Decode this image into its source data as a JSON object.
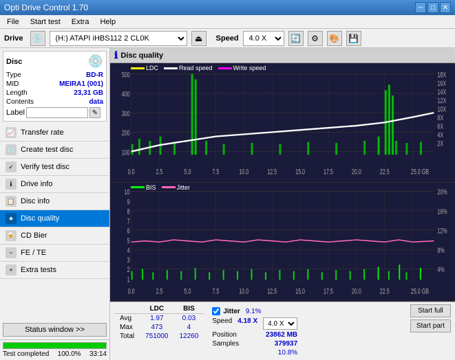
{
  "titlebar": {
    "title": "Opti Drive Control 1.70",
    "minimize": "─",
    "maximize": "□",
    "close": "✕"
  },
  "menubar": {
    "items": [
      "File",
      "Start test",
      "Extra",
      "Help"
    ]
  },
  "drivebar": {
    "label": "Drive",
    "drive_value": "(H:) ATAPI iHBS112  2 CL0K",
    "speed_label": "Speed",
    "speed_value": "4.0 X"
  },
  "disc": {
    "title": "Disc",
    "type_label": "Type",
    "type_value": "BD-R",
    "mid_label": "MID",
    "mid_value": "MEIRA1 (001)",
    "length_label": "Length",
    "length_value": "23,31 GB",
    "contents_label": "Contents",
    "contents_value": "data",
    "label_label": "Label",
    "label_value": ""
  },
  "nav": {
    "items": [
      {
        "id": "transfer-rate",
        "label": "Transfer rate",
        "active": false
      },
      {
        "id": "create-test-disc",
        "label": "Create test disc",
        "active": false
      },
      {
        "id": "verify-test-disc",
        "label": "Verify test disc",
        "active": false
      },
      {
        "id": "drive-info",
        "label": "Drive info",
        "active": false
      },
      {
        "id": "disc-info",
        "label": "Disc info",
        "active": false
      },
      {
        "id": "disc-quality",
        "label": "Disc quality",
        "active": true
      },
      {
        "id": "cd-bier",
        "label": "CD Bier",
        "active": false
      },
      {
        "id": "fe-te",
        "label": "FE / TE",
        "active": false
      },
      {
        "id": "extra-tests",
        "label": "Extra tests",
        "active": false
      }
    ]
  },
  "status_window_btn": "Status window >>",
  "progress": {
    "percent": 100,
    "percent_text": "100.0%",
    "time": "33:14",
    "status": "Test completed"
  },
  "disc_quality": {
    "title": "Disc quality"
  },
  "chart1": {
    "legend": [
      {
        "label": "LDC",
        "color": "#ffff00"
      },
      {
        "label": "Read speed",
        "color": "#ffffff"
      },
      {
        "label": "Write speed",
        "color": "#ff00ff"
      }
    ],
    "y_axis_left": [
      "500",
      "400",
      "300",
      "200",
      "100",
      "0"
    ],
    "y_axis_right": [
      "18X",
      "16X",
      "14X",
      "12X",
      "10X",
      "8X",
      "6X",
      "4X",
      "2X"
    ],
    "x_axis": [
      "0.0",
      "2.5",
      "5.0",
      "7.5",
      "10.0",
      "12.5",
      "15.0",
      "17.5",
      "20.0",
      "22.5",
      "25.0 GB"
    ]
  },
  "chart2": {
    "legend": [
      {
        "label": "BIS",
        "color": "#00ff00"
      },
      {
        "label": "Jitter",
        "color": "#ff69b4"
      }
    ],
    "y_axis_left": [
      "10",
      "9",
      "8",
      "7",
      "6",
      "5",
      "4",
      "3",
      "2",
      "1"
    ],
    "y_axis_right": [
      "20%",
      "16%",
      "12%",
      "8%",
      "4%"
    ],
    "x_axis": [
      "0.0",
      "2.5",
      "5.0",
      "7.5",
      "10.0",
      "12.5",
      "15.0",
      "17.5",
      "20.0",
      "22.5",
      "25.0 GB"
    ]
  },
  "stats": {
    "headers": [
      "",
      "LDC",
      "BIS"
    ],
    "rows": [
      {
        "label": "Avg",
        "ldc": "1.97",
        "bis": "0.03"
      },
      {
        "label": "Max",
        "ldc": "473",
        "bis": "4"
      },
      {
        "label": "Total",
        "ldc": "751000",
        "bis": "12260"
      }
    ],
    "jitter_label": "Jitter",
    "jitter_avg": "9.1%",
    "jitter_max": "10.8%",
    "speed_label": "Speed",
    "speed_value": "4.18 X",
    "speed_select": "4.0 X",
    "position_label": "Position",
    "position_value": "23862 MB",
    "samples_label": "Samples",
    "samples_value": "379937"
  },
  "buttons": {
    "start_full": "Start full",
    "start_part": "Start part"
  }
}
